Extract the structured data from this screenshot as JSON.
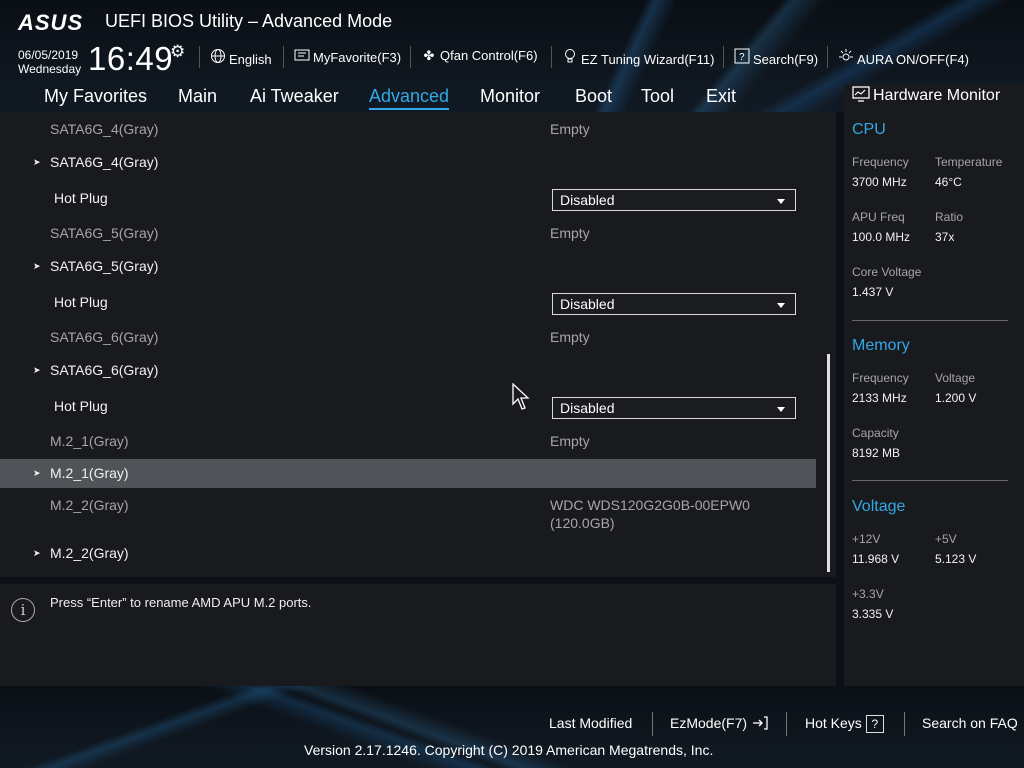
{
  "header": {
    "logo": "ASUS",
    "title": "UEFI BIOS Utility – Advanced Mode",
    "date": "06/05/2019",
    "weekday": "Wednesday",
    "time": "16:49",
    "buttons": {
      "language": "English",
      "favorite": "MyFavorite(F3)",
      "qfan": "Qfan Control(F6)",
      "eztuning": "EZ Tuning Wizard(F11)",
      "search": "Search(F9)",
      "aura": "AURA ON/OFF(F4)"
    }
  },
  "menu": {
    "items": [
      "My Favorites",
      "Main",
      "Ai Tweaker",
      "Advanced",
      "Monitor",
      "Boot",
      "Tool",
      "Exit"
    ],
    "active": "Advanced"
  },
  "rows": [
    {
      "label": "SATA6G_4(Gray)",
      "value": "Empty"
    },
    {
      "label": "SATA6G_4(Gray)"
    },
    {
      "label": "Hot Plug",
      "value": "Disabled"
    },
    {
      "label": "SATA6G_5(Gray)",
      "value": "Empty"
    },
    {
      "label": "SATA6G_5(Gray)"
    },
    {
      "label": "Hot Plug",
      "value": "Disabled"
    },
    {
      "label": "SATA6G_6(Gray)",
      "value": "Empty"
    },
    {
      "label": "SATA6G_6(Gray)"
    },
    {
      "label": "Hot Plug",
      "value": "Disabled"
    },
    {
      "label": "M.2_1(Gray)",
      "value": "Empty"
    },
    {
      "label": "M.2_1(Gray)"
    },
    {
      "label": "M.2_2(Gray)",
      "value": "WDC WDS120G2G0B-00EPW0",
      "value2": "(120.0GB)"
    },
    {
      "label": "M.2_2(Gray)"
    }
  ],
  "help_text": "Press “Enter” to rename AMD APU M.2 ports.",
  "hardware_monitor": {
    "title": "Hardware Monitor",
    "cpu": {
      "heading": "CPU",
      "frequency_label": "Frequency",
      "frequency": "3700 MHz",
      "temperature_label": "Temperature",
      "temperature": "46°C",
      "apu_label": "APU Freq",
      "apu": "100.0 MHz",
      "ratio_label": "Ratio",
      "ratio": "37x",
      "core_voltage_label": "Core Voltage",
      "core_voltage": "1.437 V"
    },
    "memory": {
      "heading": "Memory",
      "frequency_label": "Frequency",
      "frequency": "2133 MHz",
      "voltage_label": "Voltage",
      "voltage": "1.200 V",
      "capacity_label": "Capacity",
      "capacity": "8192 MB"
    },
    "voltage": {
      "heading": "Voltage",
      "v12_label": "+12V",
      "v12": "11.968 V",
      "v5_label": "+5V",
      "v5": "5.123 V",
      "v33_label": "+3.3V",
      "v33": "3.335 V"
    }
  },
  "footer": {
    "last_modified": "Last Modified",
    "ezmode": "EzMode(F7)",
    "hotkeys": "Hot Keys",
    "hotkeys_key": "?",
    "faq": "Search on FAQ",
    "copyright": "Version 2.17.1246. Copyright (C) 2019 American Megatrends, Inc."
  }
}
